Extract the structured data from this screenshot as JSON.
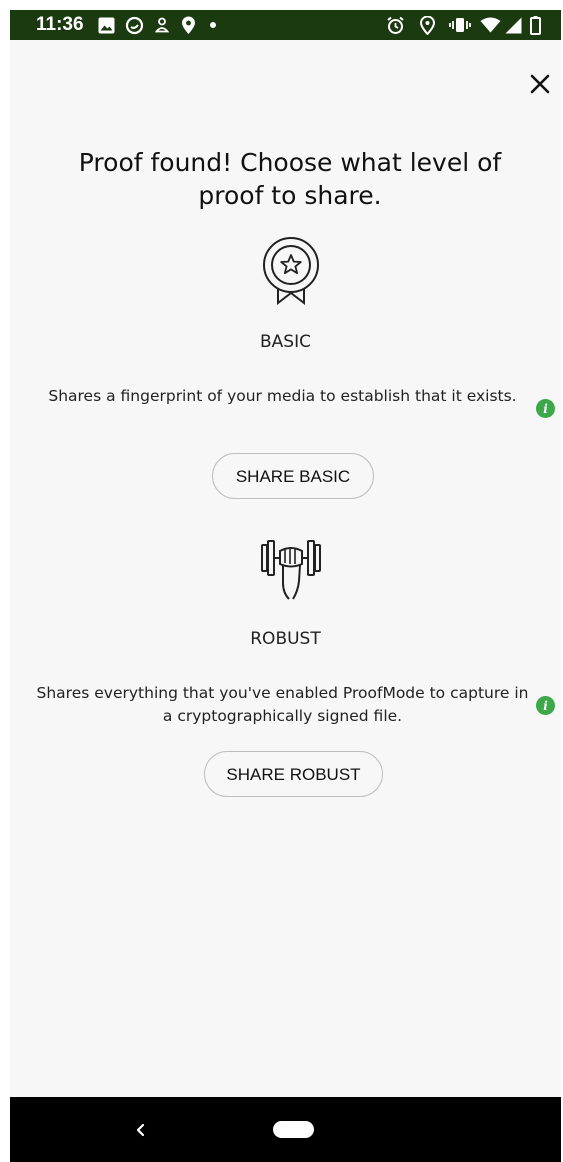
{
  "status_bar": {
    "time": "11:36",
    "left_icons": [
      "image-icon",
      "whatsapp-icon",
      "account-icon",
      "location-pin-icon",
      "dot-icon"
    ],
    "right_icons": [
      "alarm-icon",
      "location-icon",
      "vibrate-icon",
      "wifi-icon",
      "signal-icon",
      "battery-icon"
    ],
    "background_color": "#1b3a10"
  },
  "header": {
    "close_icon": "close-icon"
  },
  "title": "Proof found! Choose what level of proof to share.",
  "levels": [
    {
      "icon": "award-ribbon-icon",
      "name": "BASIC",
      "description": "Shares a fingerprint of your media to establish that it exists.",
      "button_label": "SHARE BASIC"
    },
    {
      "icon": "dumbbell-fist-icon",
      "name": "ROBUST",
      "description": "Shares everything that you've enabled ProofMode to capture in a cryptographically signed file.",
      "button_label": "SHARE ROBUST"
    }
  ],
  "info_icon": {
    "glyph": "i",
    "color": "#3da849"
  },
  "nav_bar": {
    "back_icon": "back-chevron-icon",
    "home_icon": "home-pill-icon"
  }
}
